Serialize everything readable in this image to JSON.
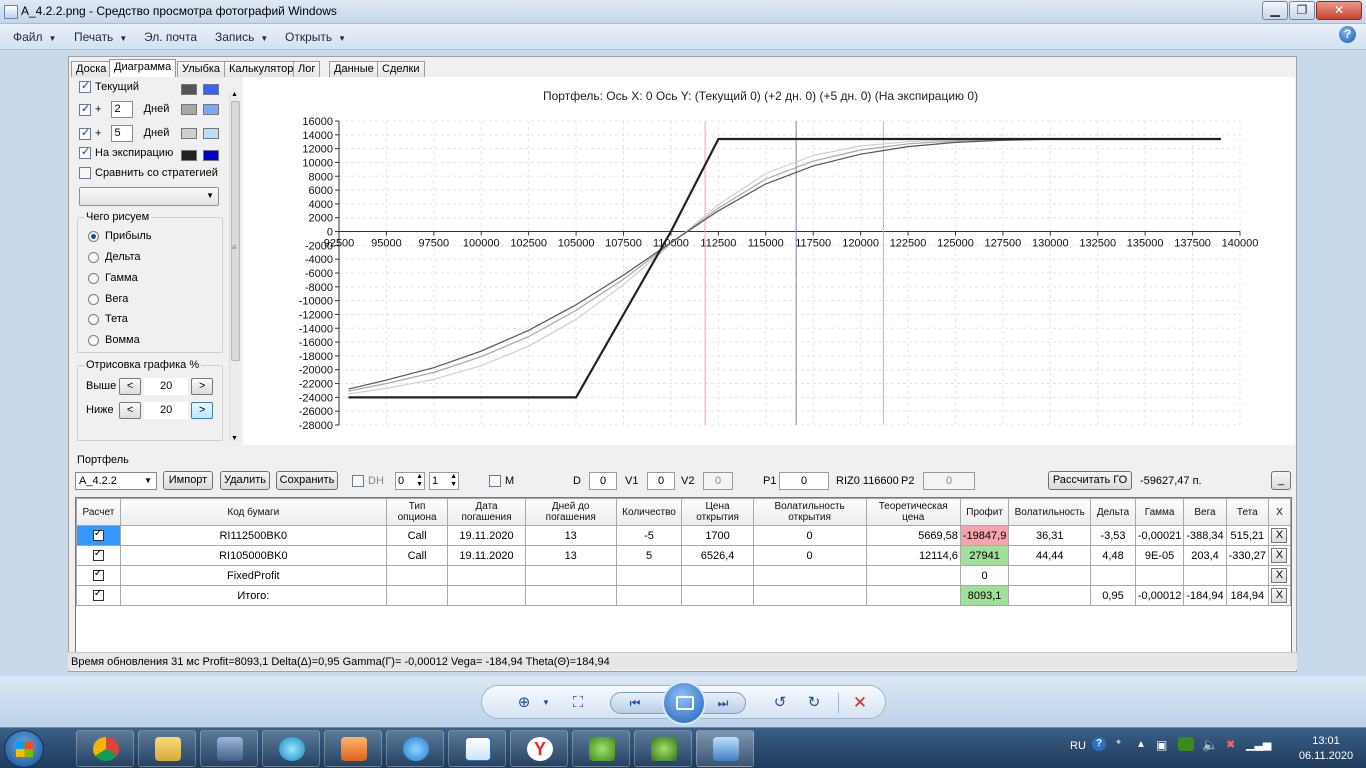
{
  "window": {
    "title": "A_4.2.2.png - Средство просмотра фотографий Windows",
    "minimize": "▁",
    "maximize": "❐",
    "close": "✕"
  },
  "menu": {
    "items": [
      {
        "label": "Файл",
        "has_caret": true
      },
      {
        "label": "Печать",
        "has_caret": true
      },
      {
        "label": "Эл. почта",
        "has_caret": false
      },
      {
        "label": "Запись",
        "has_caret": true
      },
      {
        "label": "Открыть",
        "has_caret": true
      }
    ],
    "help": "?"
  },
  "tabs": [
    "Доска",
    "Диаграмма",
    "Улыбка",
    "Калькулятор",
    "Лог",
    "Данные",
    "Сделки"
  ],
  "active_tab": "Диаграмма",
  "left_panel": {
    "current_label": "Текущий",
    "plus": "+",
    "days_label": "Дней",
    "days_1": "2",
    "days_2": "5",
    "expiration_label": "На экспирацию",
    "compare_label": "Сравнить со стратегией",
    "what_title": "Чего рисуем",
    "radio_options": [
      "Прибыль",
      "Дельта",
      "Гамма",
      "Вега",
      "Тета",
      "Вомма"
    ],
    "selected_radio": "Прибыль",
    "render_title": "Отрисовка графика %",
    "above_label": "Выше",
    "below_label": "Ниже",
    "above_value": "20",
    "below_value": "20",
    "btn_left": "<",
    "btn_right": ">",
    "colors": {
      "current": [
        "#555555",
        "#3366ff"
      ],
      "plus2": [
        "#a8a8a8",
        "#77aaff"
      ],
      "plus5": [
        "#cfcfcf",
        "#b9dcff"
      ],
      "expiration": [
        "#222222",
        "#0000cc"
      ]
    }
  },
  "chart_title": "Портфель: Ось X: 0 Ось Y:  (Текущий 0)  (+2 дн. 0)  (+5 дн. 0)  (На экспирацию 0)",
  "chart_data": {
    "type": "line",
    "xlim": [
      92500,
      140000
    ],
    "ylim": [
      -28000,
      16000
    ],
    "x_ticks": [
      92500,
      95000,
      97500,
      100000,
      102500,
      105000,
      107500,
      110000,
      112500,
      115000,
      117500,
      120000,
      122500,
      125000,
      127500,
      130000,
      132500,
      135000,
      137500,
      140000
    ],
    "y_ticks": [
      16000,
      14000,
      12000,
      10000,
      8000,
      6000,
      4000,
      2000,
      0,
      -2000,
      -4000,
      -6000,
      -8000,
      -10000,
      -12000,
      -14000,
      -16000,
      -18000,
      -20000,
      -22000,
      -24000,
      -26000,
      -28000
    ],
    "grid": true,
    "vertical_lines": [
      {
        "x": 111800,
        "color": "#f4a0b0"
      },
      {
        "x": 116600,
        "color": "#7a86a8"
      },
      {
        "x": 121200,
        "color": "#f4a0b0"
      }
    ],
    "series": [
      {
        "color": "#222222",
        "width": 2.2,
        "x": [
          93000,
          105000,
          110000,
          112500,
          139000
        ],
        "y": [
          -24000,
          -24000,
          0,
          13400,
          13400
        ]
      },
      {
        "color": "#555555",
        "width": 1.2,
        "x": [
          93000,
          95000,
          97500,
          100000,
          102500,
          105000,
          107500,
          110000,
          112500,
          115000,
          117500,
          120000,
          122500,
          125000,
          127500,
          130000,
          135000,
          139000
        ],
        "y": [
          -22800,
          -21500,
          -19700,
          -17300,
          -14300,
          -10600,
          -6300,
          -1600,
          3000,
          6900,
          9500,
          11200,
          12300,
          12900,
          13200,
          13350,
          13400,
          13400
        ]
      },
      {
        "color": "#a8a8a8",
        "width": 1.2,
        "x": [
          93000,
          95000,
          97500,
          100000,
          102500,
          105000,
          107500,
          110000,
          112500,
          115000,
          117500,
          120000,
          122500,
          125000,
          127500,
          130000,
          135000,
          139000
        ],
        "y": [
          -23100,
          -22000,
          -20400,
          -18100,
          -15200,
          -11400,
          -6900,
          -1700,
          3400,
          7600,
          10200,
          11800,
          12700,
          13100,
          13300,
          13400,
          13400,
          13400
        ]
      },
      {
        "color": "#cfcfcf",
        "width": 1.2,
        "x": [
          93000,
          95000,
          97500,
          100000,
          102500,
          105000,
          107500,
          110000,
          112500,
          115000,
          117500,
          120000,
          122500,
          125000,
          127500,
          130000,
          135000,
          139000
        ],
        "y": [
          -23500,
          -22700,
          -21400,
          -19400,
          -16600,
          -12700,
          -7700,
          -1800,
          3900,
          8400,
          11000,
          12400,
          13000,
          13300,
          13400,
          13400,
          13400,
          13400
        ]
      }
    ]
  },
  "portfolio": {
    "label": "Портфель",
    "name": "A_4.2.2",
    "import": "Импорт",
    "delete": "Удалить",
    "save": "Сохранить",
    "dh_label": "DH",
    "dh_val1": "0",
    "dh_val2": "1",
    "m_label": "M",
    "d_label": "D",
    "d_val": "0",
    "v1_label": "V1",
    "v1_val": "0",
    "v2_label": "V2",
    "v2_val": "0",
    "p1_label": "P1",
    "p1_val": "0",
    "riz_label": "RIZ0 116600",
    "p2_label": "P2",
    "p2_val": "0",
    "calc_go": "Рассчитать ГО",
    "go_value": "-59627,47 п.",
    "collapse": "_"
  },
  "table": {
    "headers": [
      "Расчет",
      "Код бумаги",
      "Тип опциона",
      "Дата погашения",
      "Дней до погашения",
      "Количество",
      "Цена открытия",
      "Волатильность открытия",
      "Теоретическая цена",
      "Профит",
      "Волатильность",
      "Дельта",
      "Гамма",
      "Вега",
      "Тета",
      "X"
    ],
    "rows": [
      {
        "code": "RI112500BK0",
        "type": "Call",
        "date": "19.11.2020",
        "days": "13",
        "qty": "-5",
        "price": "1700",
        "vol_open": "0",
        "theo": "5669,58",
        "profit": "-19847,9",
        "vol": "36,31",
        "delta": "-3,53",
        "gamma": "-0,00021",
        "vega": "-388,34",
        "theta": "515,21",
        "x": "X"
      },
      {
        "code": "RI105000BK0",
        "type": "Call",
        "date": "19.11.2020",
        "days": "13",
        "qty": "5",
        "price": "6526,4",
        "vol_open": "0",
        "theo": "12114,6",
        "profit": "27941",
        "vol": "44,44",
        "delta": "4,48",
        "gamma": "9E-05",
        "vega": "203,4",
        "theta": "-330,27",
        "x": "X"
      },
      {
        "code": "FixedProfit",
        "type": "",
        "date": "",
        "days": "",
        "qty": "",
        "price": "",
        "vol_open": "",
        "theo": "",
        "profit": "0",
        "vol": "",
        "delta": "",
        "gamma": "",
        "vega": "",
        "theta": "",
        "x": "X"
      },
      {
        "code": "Итого:",
        "type": "",
        "date": "",
        "days": "",
        "qty": "",
        "price": "",
        "vol_open": "",
        "theo": "",
        "profit": "8093,1",
        "vol": "",
        "delta": "0,95",
        "gamma": "-0,00012",
        "vega": "-184,94",
        "theta": "184,94",
        "x": "X"
      }
    ]
  },
  "status": "Время обновления 31 мс  Profit=8093,1 Delta(Δ)=0,95 Gamma(Г)= -0,00012 Vega= -184,94 Theta(Θ)=184,94",
  "tray": {
    "lang": "RU",
    "time": "13:01",
    "date": "06.11.2020"
  }
}
